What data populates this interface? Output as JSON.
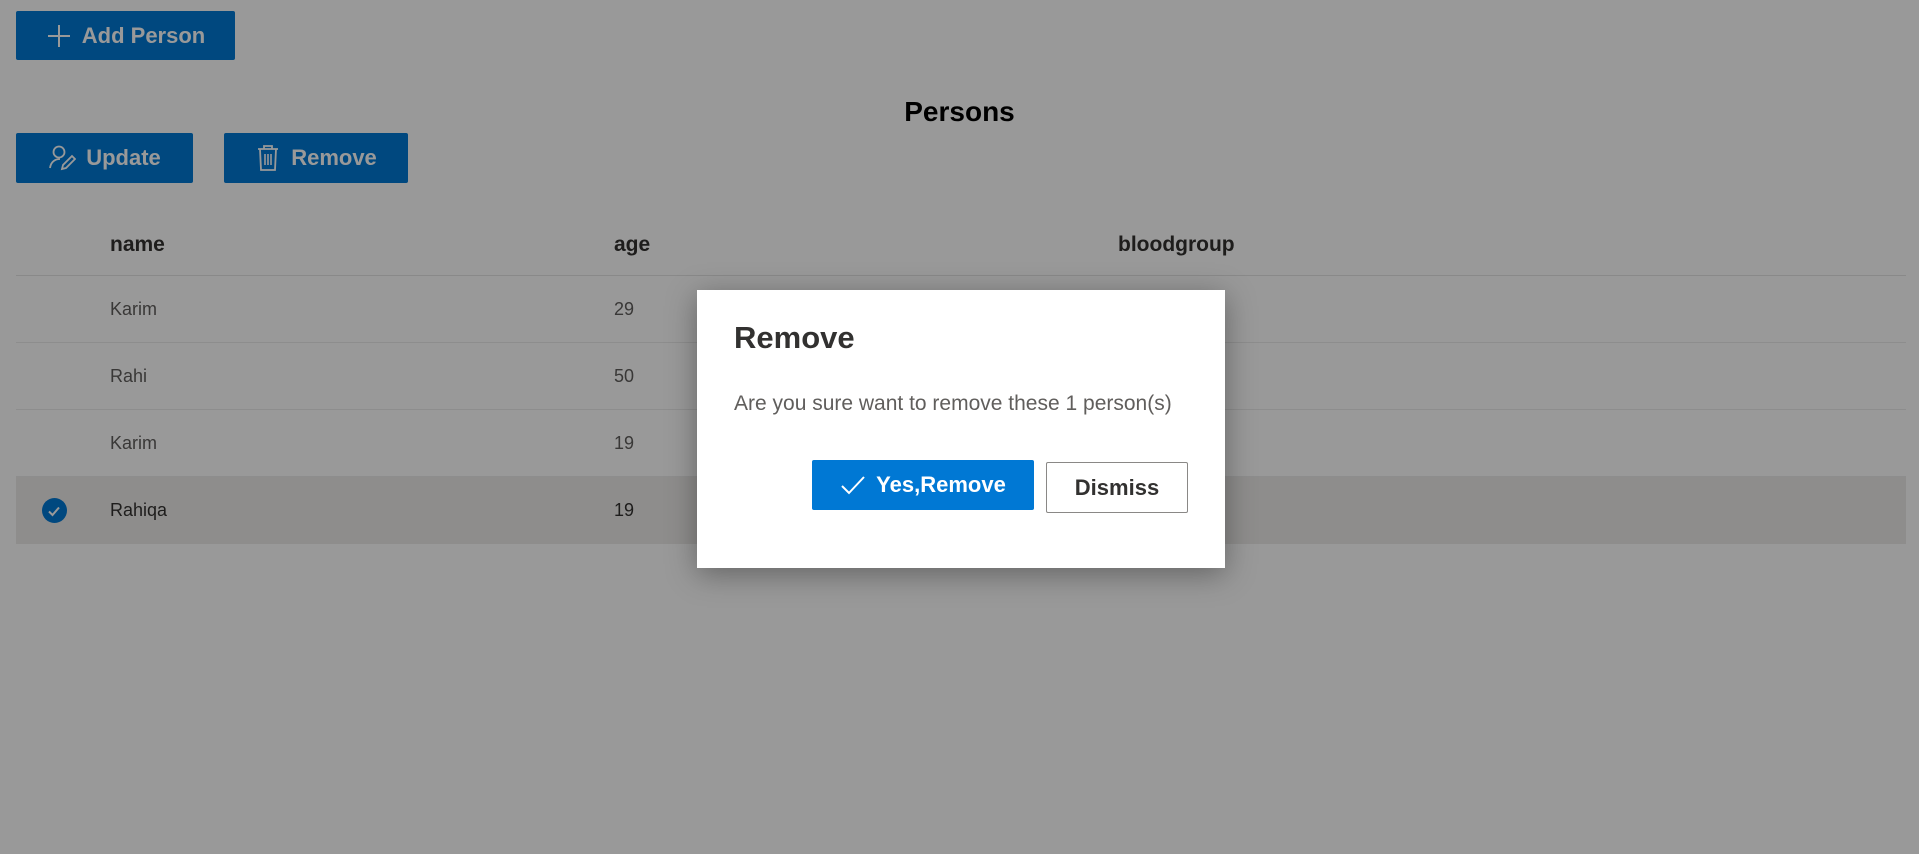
{
  "toolbar": {
    "add_label": "Add Person",
    "update_label": "Update",
    "remove_label": "Remove"
  },
  "page": {
    "title": "Persons"
  },
  "table": {
    "columns": [
      "name",
      "age",
      "bloodgroup"
    ],
    "rows": [
      {
        "name": "Karim",
        "age": "29",
        "selected": false
      },
      {
        "name": "Rahi",
        "age": "50",
        "selected": false
      },
      {
        "name": "Karim",
        "age": "19",
        "selected": false
      },
      {
        "name": "Rahiqa",
        "age": "19",
        "selected": true
      }
    ]
  },
  "dialog": {
    "title": "Remove",
    "message": "Are you sure want to remove these 1 person(s)",
    "confirm_label": "Yes,Remove",
    "dismiss_label": "Dismiss"
  },
  "colors": {
    "accent": "#0078d4",
    "overlay": "rgba(0,0,0,0.4)"
  },
  "icons": {
    "add": "plus-icon",
    "update": "person-edit-icon",
    "remove": "trash-icon",
    "confirm": "checkmark-icon",
    "row_selected": "check-circle-icon"
  }
}
